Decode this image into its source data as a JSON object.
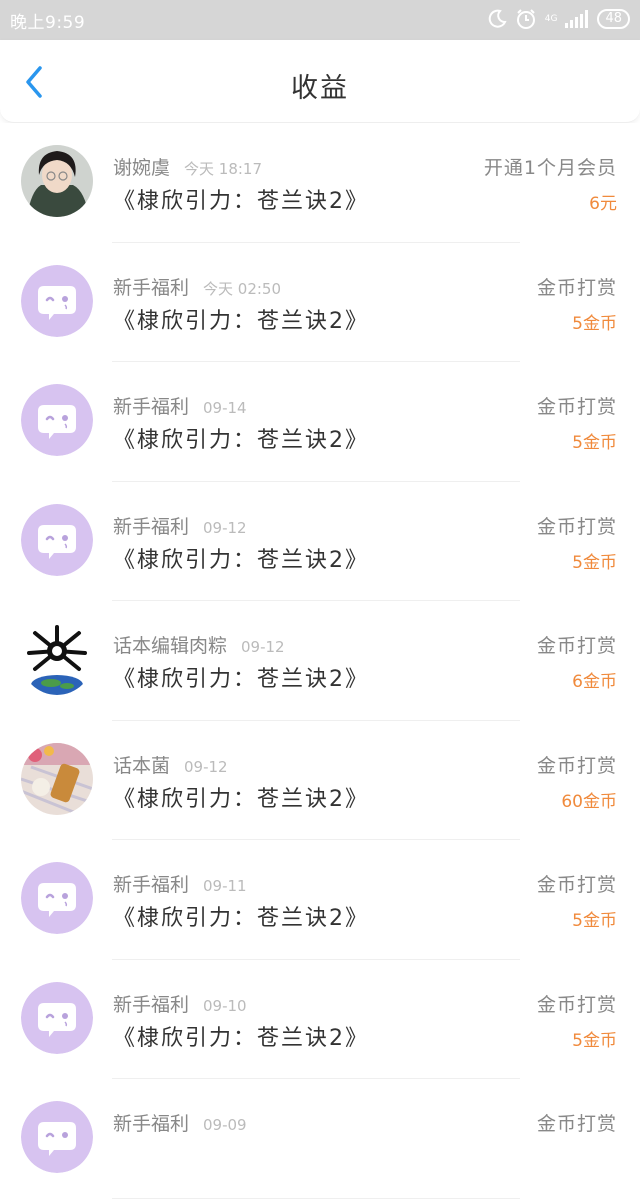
{
  "status_bar": {
    "time": "晚上9:59",
    "network": "4G",
    "battery": "48"
  },
  "header": {
    "title": "收益"
  },
  "colors": {
    "amount": "#f08a3c",
    "back_arrow": "#2a96ee",
    "bot_avatar": "#d7c3f0"
  },
  "rows": [
    {
      "name": "谢婉虞",
      "time": "今天 18:17",
      "book": "《棣欣引力：苍兰诀2》",
      "type": "开通1个月会员",
      "amount": "6元",
      "avatar": "photo-portrait"
    },
    {
      "name": "新手福利",
      "time": "今天 02:50",
      "book": "《棣欣引力：苍兰诀2》",
      "type": "金币打赏",
      "amount": "5金币",
      "avatar": "bot-chat-icon"
    },
    {
      "name": "新手福利",
      "time": "09-14",
      "book": "《棣欣引力：苍兰诀2》",
      "type": "金币打赏",
      "amount": "5金币",
      "avatar": "bot-chat-icon"
    },
    {
      "name": "新手福利",
      "time": "09-12",
      "book": "《棣欣引力：苍兰诀2》",
      "type": "金币打赏",
      "amount": "5金币",
      "avatar": "bot-chat-icon"
    },
    {
      "name": "话本编辑肉粽",
      "time": "09-12",
      "book": "《棣欣引力：苍兰诀2》",
      "type": "金币打赏",
      "amount": "6金币",
      "avatar": "globe-cartoon"
    },
    {
      "name": "话本菌",
      "time": "09-12",
      "book": "《棣欣引力：苍兰诀2》",
      "type": "金币打赏",
      "amount": "60金币",
      "avatar": "photo-food"
    },
    {
      "name": "新手福利",
      "time": "09-11",
      "book": "《棣欣引力：苍兰诀2》",
      "type": "金币打赏",
      "amount": "5金币",
      "avatar": "bot-chat-icon"
    },
    {
      "name": "新手福利",
      "time": "09-10",
      "book": "《棣欣引力：苍兰诀2》",
      "type": "金币打赏",
      "amount": "5金币",
      "avatar": "bot-chat-icon"
    },
    {
      "name": "新手福利",
      "time": "09-09",
      "book": "",
      "type": "金币打赏",
      "amount": "",
      "avatar": "bot-chat-icon"
    }
  ]
}
